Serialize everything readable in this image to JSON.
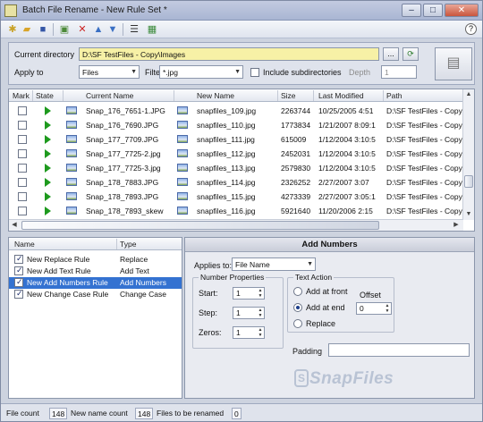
{
  "window": {
    "title": "Batch File Rename - New Rule Set *",
    "minimize": "–",
    "maximize": "□",
    "close": "✕"
  },
  "toolbar": {
    "icons": [
      "new-icon",
      "open-icon",
      "save-icon",
      "add-rule-icon",
      "delete-icon",
      "move-up-icon",
      "move-down-icon",
      "list-icon",
      "export-icon"
    ],
    "help": "?"
  },
  "directory": {
    "current_label": "Current directory",
    "current_value": "D:\\SF TestFiles - Copy\\Images",
    "browse_label": "...",
    "apply_to_label": "Apply to",
    "apply_to_value": "Files",
    "filter_label": "Filter",
    "filter_value": "*.jpg",
    "include_subdirs_label": "Include subdirectories",
    "include_subdirs_checked": false,
    "depth_label": "Depth",
    "depth_value": "1"
  },
  "file_list": {
    "columns": [
      "Mark",
      "State",
      "Current Name",
      "New Name",
      "Size",
      "Last Modified",
      "Path"
    ],
    "rows": [
      {
        "current": "Snap_176_7651-1.JPG",
        "new": "snapfiles_109.jpg",
        "size": "2263744",
        "modified": "10/25/2005 4:51",
        "path": "D:\\SF TestFiles - Copy\\"
      },
      {
        "current": "Snap_176_7690.JPG",
        "new": "snapfiles_110.jpg",
        "size": "1773834",
        "modified": "1/21/2007 8:09:1",
        "path": "D:\\SF TestFiles - Copy\\"
      },
      {
        "current": "Snap_177_7709.JPG",
        "new": "snapfiles_111.jpg",
        "size": "615009",
        "modified": "1/12/2004 3:10:5",
        "path": "D:\\SF TestFiles - Copy\\"
      },
      {
        "current": "Snap_177_7725-2.jpg",
        "new": "snapfiles_112.jpg",
        "size": "2452031",
        "modified": "1/12/2004 3:10:5",
        "path": "D:\\SF TestFiles - Copy\\"
      },
      {
        "current": "Snap_177_7725-3.jpg",
        "new": "snapfiles_113.jpg",
        "size": "2579830",
        "modified": "1/12/2004 3:10:5",
        "path": "D:\\SF TestFiles - Copy\\"
      },
      {
        "current": "Snap_178_7883.JPG",
        "new": "snapfiles_114.jpg",
        "size": "2326252",
        "modified": "2/27/2007 3:07",
        "path": "D:\\SF TestFiles - Copy\\"
      },
      {
        "current": "Snap_178_7893.JPG",
        "new": "snapfiles_115.jpg",
        "size": "4273339",
        "modified": "2/27/2007 3:05:1",
        "path": "D:\\SF TestFiles - Copy\\"
      },
      {
        "current": "Snap_178_7893_skew",
        "new": "snapfiles_116.jpg",
        "size": "5921640",
        "modified": "11/20/2006 2:15",
        "path": "D:\\SF TestFiles - Copy\\"
      }
    ]
  },
  "rules": {
    "columns": [
      "Name",
      "Type"
    ],
    "items": [
      {
        "name": "New Replace Rule",
        "type": "Replace",
        "checked": true
      },
      {
        "name": "New Add Text Rule",
        "type": "Add Text",
        "checked": true
      },
      {
        "name": "New Add Numbers Rule",
        "type": "Add Numbers",
        "checked": true
      },
      {
        "name": "New Change Case Rule",
        "type": "Change Case",
        "checked": true
      }
    ]
  },
  "rule_panel": {
    "title": "Add Numbers",
    "applies_to_label": "Applies to:",
    "applies_to_value": "File Name",
    "number_props_title": "Number Properties",
    "start_label": "Start:",
    "start_value": "1",
    "step_label": "Step:",
    "step_value": "1",
    "zeros_label": "Zeros:",
    "zeros_value": "1",
    "text_action_title": "Text Action",
    "add_front_label": "Add at front",
    "add_end_label": "Add at end",
    "replace_label": "Replace",
    "offset_label": "Offset",
    "offset_value": "0",
    "padding_label": "Padding",
    "padding_value": ""
  },
  "watermark": {
    "mark": "S",
    "text": "SnapFiles"
  },
  "status": {
    "file_count_label": "File count",
    "file_count": "148",
    "new_name_count_label": "New name count",
    "new_name_count": "148",
    "to_rename_label": "Files to be renamed",
    "to_rename": "0"
  },
  "colors": {
    "accent": "#3472d1",
    "dir_field": "#f7f1a6",
    "play": "#1e9a1e"
  }
}
